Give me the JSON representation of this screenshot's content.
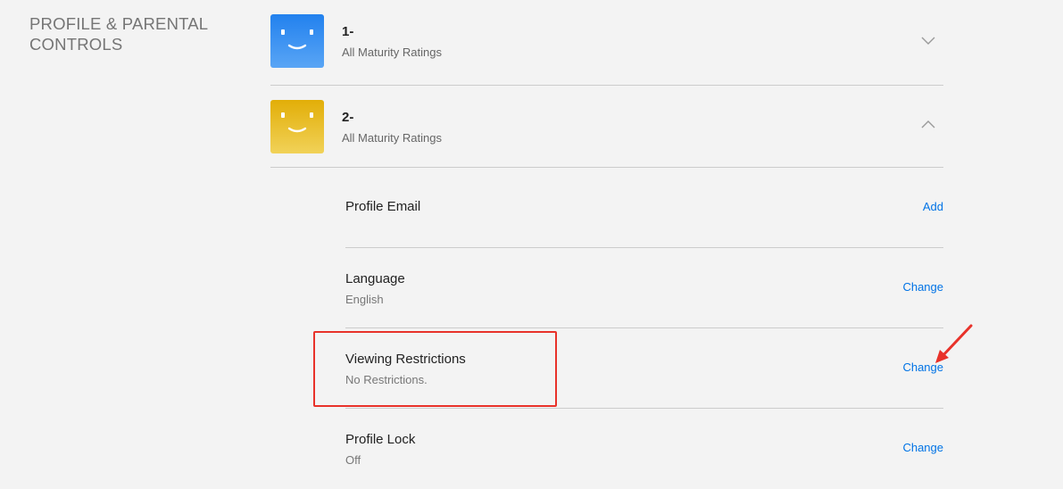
{
  "section": {
    "title": "PROFILE & PARENTAL CONTROLS"
  },
  "profiles": [
    {
      "name": "1-",
      "rating": "All Maturity Ratings",
      "avatar_color_top": "#2b87f0",
      "avatar_color_bottom": "#5aa6f6",
      "expanded": false
    },
    {
      "name": "2-",
      "rating": "All Maturity Ratings",
      "avatar_color_top": "#e5b40f",
      "avatar_color_bottom": "#f0cf4a",
      "expanded": true
    }
  ],
  "settings": {
    "profile_email": {
      "label": "Profile Email",
      "action": "Add"
    },
    "language": {
      "label": "Language",
      "value": "English",
      "action": "Change"
    },
    "viewing_restrictions": {
      "label": "Viewing Restrictions",
      "value": "No Restrictions.",
      "action": "Change"
    },
    "profile_lock": {
      "label": "Profile Lock",
      "value": "Off",
      "action": "Change"
    }
  },
  "colors": {
    "link": "#0073e6",
    "annotation": "#e8322a",
    "divider": "#cccccc",
    "background": "#f3f3f3"
  }
}
